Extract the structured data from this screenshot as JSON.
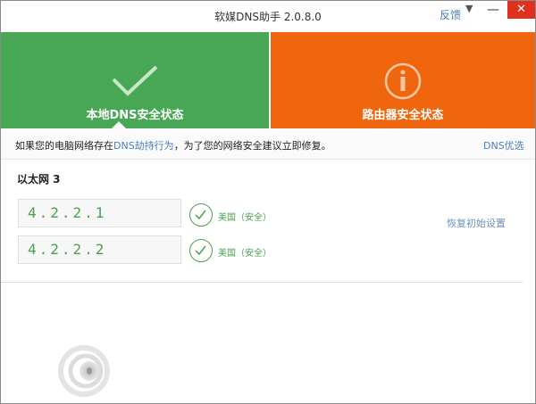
{
  "window": {
    "title": "软媒DNS助手 2.0.8.0",
    "feedback": "反馈",
    "menu_icon": "▼",
    "minimize_icon": "—",
    "close_icon": "✕"
  },
  "panels": [
    {
      "label": "本地DNS安全状态",
      "icon": "check-icon",
      "color": "#48a755"
    },
    {
      "label": "路由器安全状态",
      "icon": "info-icon",
      "color": "#f0660f"
    }
  ],
  "infobar": {
    "text_before": "如果您的电脑网络存在",
    "link": "DNS劫持行为",
    "text_after": "，为了您的网络安全建议立即修复。",
    "dns_optimize": "DNS优选"
  },
  "network": {
    "name": "以太网 3",
    "dns": [
      {
        "ip": "4.2.2.1",
        "status": "美国（安全）"
      },
      {
        "ip": "4.2.2.2",
        "status": "美国（安全）"
      }
    ],
    "restore": "恢复初始设置"
  }
}
